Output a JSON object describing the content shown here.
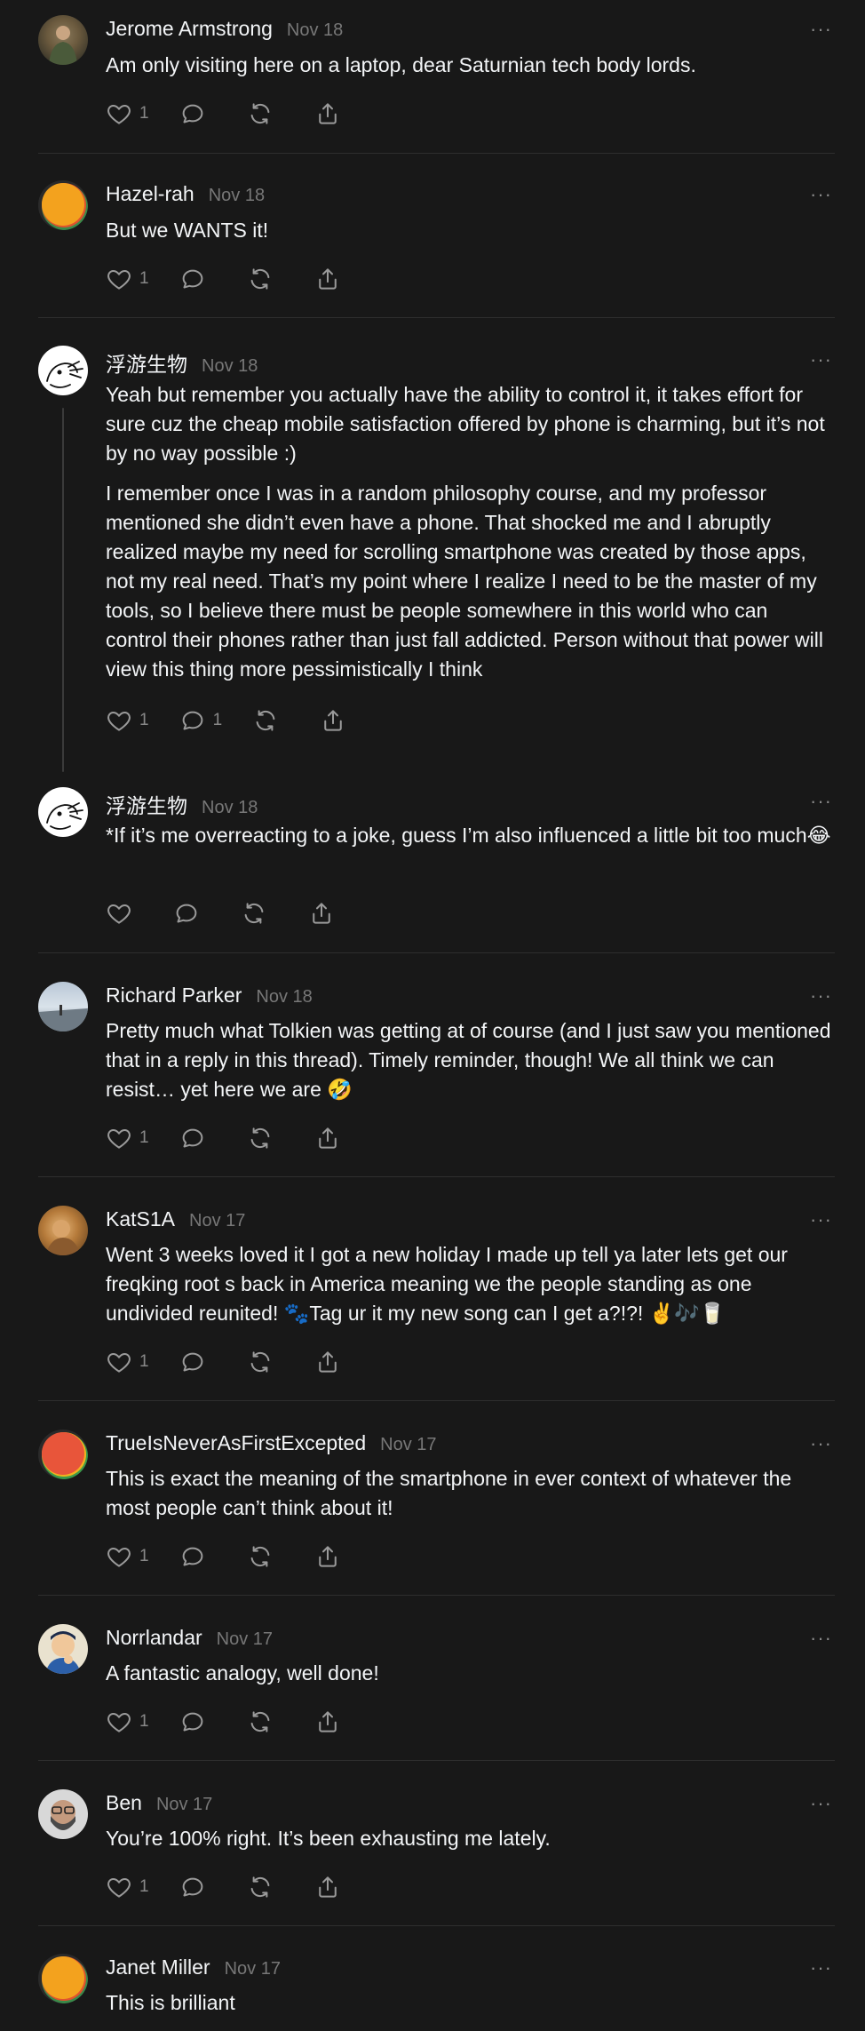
{
  "posts": [
    {
      "name": "Jerome Armstrong",
      "date": "Nov 18",
      "paragraphs": [
        "Am only visiting here on a laptop, dear Saturnian tech body lords."
      ],
      "likes": "1",
      "replies": ""
    },
    {
      "name": "Hazel-rah",
      "date": "Nov 18",
      "paragraphs": [
        "But we WANTS it!"
      ],
      "likes": "1",
      "replies": ""
    },
    {
      "name": "浮游生物",
      "date": "Nov 18",
      "paragraphs": [
        "Yeah but remember you actually have the ability to control it, it takes effort for sure cuz the cheap mobile satisfaction offered by phone is charming, but it’s not by no way possible :)",
        "I remember once I was in a random philosophy course, and my professor mentioned she didn’t even have a phone. That shocked me and I abruptly realized maybe my need for scrolling smartphone was created by those apps, not my real need. That’s my point where I realize I need to be the master of my tools, so I believe there must be people somewhere in this world who can control their phones rather than just fall addicted. Person without that power will view this thing more pessimistically I think"
      ],
      "likes": "1",
      "replies": "1"
    },
    {
      "name": "浮游生物",
      "date": "Nov 18",
      "paragraphs": [
        "*If it’s me overreacting to a joke, guess I’m also influenced a little bit too much😂"
      ],
      "likes": "",
      "replies": ""
    },
    {
      "name": "Richard Parker",
      "date": "Nov 18",
      "paragraphs": [
        "Pretty much what Tolkien was getting at of course (and I just saw you mentioned that in a reply in this thread). Timely reminder, though! We all think we can resist… yet here we are 🤣"
      ],
      "likes": "1",
      "replies": ""
    },
    {
      "name": "KatS1A",
      "date": "Nov 17",
      "paragraphs": [
        "Went 3 weeks loved it I got a new holiday I made up tell ya later lets get our freqking root s back in America meaning we the people standing as one undivided reunited! 🐾Tag ur it my new song can I get a?!?! ✌️🎶🥛"
      ],
      "likes": "1",
      "replies": ""
    },
    {
      "name": "TrueIsNeverAsFirstExcepted",
      "date": "Nov 17",
      "paragraphs": [
        "This is exact the meaning of the smartphone in ever context of whatever the most people can’t think about it!"
      ],
      "likes": "1",
      "replies": ""
    },
    {
      "name": "Norrlandar",
      "date": "Nov 17",
      "paragraphs": [
        "A fantastic analogy, well done!"
      ],
      "likes": "1",
      "replies": ""
    },
    {
      "name": "Ben",
      "date": "Nov 17",
      "paragraphs": [
        "You’re 100% right. It’s been exhausting me lately."
      ],
      "likes": "1",
      "replies": ""
    },
    {
      "name": "Janet Miller",
      "date": "Nov 17",
      "paragraphs": [
        "This is brilliant"
      ],
      "likes": "",
      "replies": ""
    }
  ],
  "icons": {
    "like": "heart-icon",
    "reply": "comment-icon",
    "repost": "repost-icon",
    "share": "share-icon",
    "more": "more-icon"
  },
  "more_glyph": "···",
  "colors": {
    "background": "#181818",
    "text": "#f3f5f7",
    "muted": "#777777",
    "divider": "#2e2e2e"
  }
}
